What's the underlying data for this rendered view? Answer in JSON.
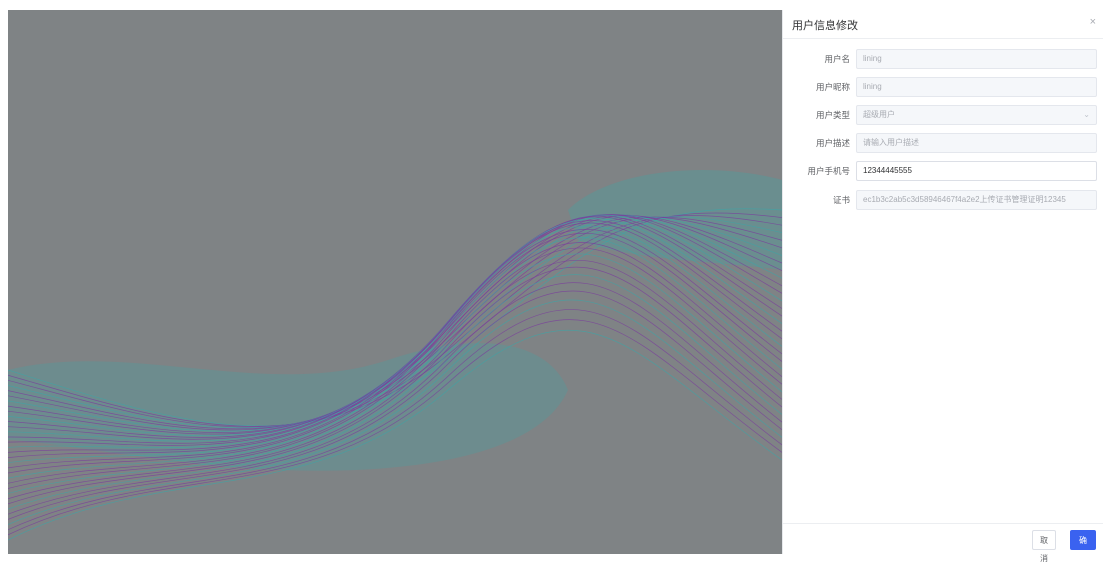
{
  "drawer": {
    "title": "用户信息修改",
    "close_label": "×",
    "fields": [
      {
        "label": "用户名",
        "value": "lining",
        "type": "text",
        "disabled": true
      },
      {
        "label": "用户昵称",
        "value": "lining",
        "type": "text",
        "disabled": true
      },
      {
        "label": "用户类型",
        "value": "超级用户",
        "type": "select",
        "disabled": true
      },
      {
        "label": "用户描述",
        "value": "请输入用户描述",
        "type": "text",
        "disabled": true
      },
      {
        "label": "用户手机号",
        "value": "12344445555",
        "type": "text",
        "disabled": false
      },
      {
        "label": "证书",
        "value": "ec1b3c2ab5c3d58946467f4a2e2上传证书管理证明12345",
        "type": "text",
        "disabled": true
      }
    ],
    "footer": {
      "cancel_label": "取消",
      "confirm_label": "确认"
    }
  },
  "colors": {
    "backdrop": "#7f8385",
    "primary": "#3a62f0",
    "wave_teal": "#3fa4a6",
    "wave_purple": "#7a3e9c"
  }
}
